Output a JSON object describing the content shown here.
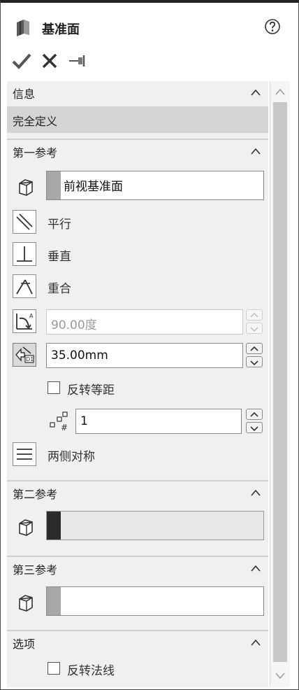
{
  "title": "基准面",
  "icons": {
    "title": "plane-icon",
    "help": "help-icon",
    "ok": "checkmark-icon",
    "cancel": "close-icon",
    "pin": "pushpin-icon"
  },
  "sections": {
    "info": {
      "title": "信息",
      "message": "完全定义"
    },
    "first_ref": {
      "title": "第一参考",
      "selection": "前视基准面",
      "options": {
        "parallel": "平行",
        "perpendicular": "垂直",
        "coincident": "重合"
      },
      "angle": {
        "value": "90.00度",
        "enabled": false
      },
      "distance": {
        "value": "35.00mm",
        "selected": true
      },
      "flip_offset": {
        "label": "反转等距",
        "checked": false
      },
      "instances": {
        "value": "1"
      },
      "mid_plane": "两侧对称"
    },
    "second_ref": {
      "title": "第二参考",
      "selection": ""
    },
    "third_ref": {
      "title": "第三参考",
      "selection": ""
    },
    "options": {
      "title": "选项",
      "flip_normal": {
        "label": "反转法线",
        "checked": false
      }
    }
  }
}
